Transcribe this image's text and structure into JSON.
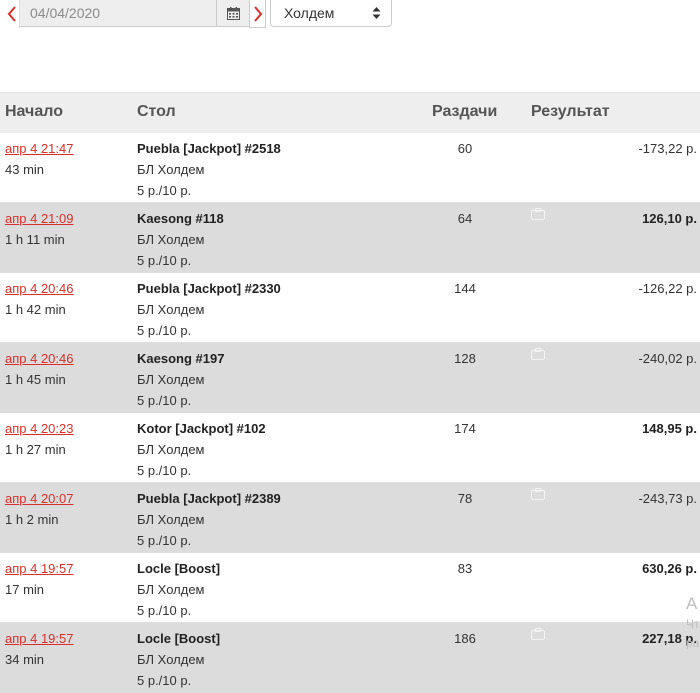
{
  "filters": {
    "date_value": "04/04/2020",
    "prev_icon": "chevron-left-icon",
    "next_icon": "chevron-right-icon",
    "calendar_icon": "calendar-icon",
    "game_selected": "Холдем"
  },
  "table": {
    "headers": {
      "start": "Начало",
      "table": "Стол",
      "hands": "Раздачи",
      "result": "Результат"
    },
    "rows": [
      {
        "start": "апр 4 21:47",
        "duration": "43 min",
        "table": "Puebla [Jackpot] #2518",
        "game": "БЛ Холдем",
        "stakes": "5 р./10 р.",
        "hands": "60",
        "result": "-173,22 р.",
        "positive": false,
        "note": false
      },
      {
        "start": "апр 4 21:09",
        "duration": "1 h 11 min",
        "table": "Kaesong #118",
        "game": "БЛ Холдем",
        "stakes": "5 р./10 р.",
        "hands": "64",
        "result": "126,10 р.",
        "positive": true,
        "note": true
      },
      {
        "start": "апр 4 20:46",
        "duration": "1 h 42 min",
        "table": "Puebla [Jackpot] #2330",
        "game": "БЛ Холдем",
        "stakes": "5 р./10 р.",
        "hands": "144",
        "result": "-126,22 р.",
        "positive": false,
        "note": false
      },
      {
        "start": "апр 4 20:46",
        "duration": "1 h 45 min",
        "table": "Kaesong #197",
        "game": "БЛ Холдем",
        "stakes": "5 р./10 р.",
        "hands": "128",
        "result": "-240,02 р.",
        "positive": false,
        "note": true
      },
      {
        "start": "апр 4 20:23",
        "duration": "1 h 27 min",
        "table": "Kotor [Jackpot] #102",
        "game": "БЛ Холдем",
        "stakes": "5 р./10 р.",
        "hands": "174",
        "result": "148,95 р.",
        "positive": true,
        "note": false
      },
      {
        "start": "апр 4 20:07",
        "duration": "1 h 2 min",
        "table": "Puebla [Jackpot] #2389",
        "game": "БЛ Холдем",
        "stakes": "5 р./10 р.",
        "hands": "78",
        "result": "-243,73 р.",
        "positive": false,
        "note": true
      },
      {
        "start": "апр 4 19:57",
        "duration": "17 min",
        "table": "Locle [Boost]",
        "game": "БЛ Холдем",
        "stakes": "5 р./10 р.",
        "hands": "83",
        "result": "630,26 р.",
        "positive": true,
        "note": false
      },
      {
        "start": "апр 4 19:57",
        "duration": "34 min",
        "table": "Locle [Boost]",
        "game": "БЛ Холдем",
        "stakes": "5 р./10 р.",
        "hands": "186",
        "result": "227,18 р.",
        "positive": true,
        "note": true
      }
    ]
  },
  "side_overlay": [
    "А",
    "Чт",
    "ра"
  ],
  "colors": {
    "accent": "#d9302a",
    "header_bg": "#eeeeee",
    "alt_row_bg": "#dcdcdc"
  }
}
